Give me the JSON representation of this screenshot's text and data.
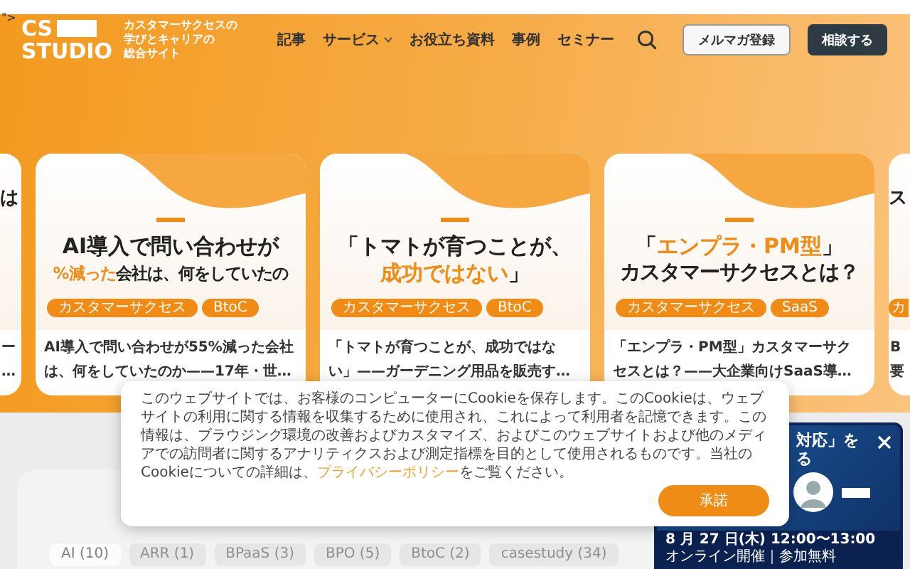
{
  "stray_text": "\">",
  "header": {
    "logo": {
      "top": "CS",
      "bottom": "STUDIO"
    },
    "tagline": [
      "カスタマーサクセスの",
      "学びとキャリアの",
      "総合サイト"
    ],
    "nav": [
      {
        "label": "記事",
        "dropdown": false
      },
      {
        "label": "サービス",
        "dropdown": true
      },
      {
        "label": "お役立ち資料",
        "dropdown": false
      },
      {
        "label": "事例",
        "dropdown": false
      },
      {
        "label": "セミナー",
        "dropdown": false
      }
    ],
    "buttons": [
      {
        "label": "メルマガ登録",
        "kind": "outline"
      },
      {
        "label": "相談する",
        "kind": "dark"
      }
    ]
  },
  "cards": [
    {
      "headline": [
        [
          {
            "text": "は",
            "accent": false
          }
        ]
      ],
      "title": [
        "ー",
        "…"
      ]
    },
    {
      "headline": [
        [
          {
            "text": "AI導入で問い合わせが",
            "accent": false
          }
        ],
        [
          {
            "text": "%減った",
            "accent": true
          },
          {
            "text": "会社は、何をしていたの",
            "accent": false
          }
        ]
      ],
      "tags": [
        "カスタマーサクセス",
        "BtoC"
      ],
      "title": [
        "AI導入で問い合わせが55%減った会社",
        "は、何をしていたのか——17年・世…"
      ]
    },
    {
      "headline": [
        [
          {
            "text": "「トマトが育つことが、",
            "accent": false
          }
        ],
        [
          {
            "text": "成功ではない",
            "accent": true
          },
          {
            "text": "」",
            "accent": false
          }
        ]
      ],
      "tags": [
        "カスタマーサクセス",
        "BtoC"
      ],
      "title": [
        "「トマトが育つことが、成功ではな",
        "い」——ガーデニング用品を販売す…"
      ]
    },
    {
      "headline": [
        [
          {
            "text": "「",
            "accent": false
          },
          {
            "text": "エンプラ・PM型",
            "accent": true
          },
          {
            "text": "」",
            "accent": false
          }
        ],
        [
          {
            "text": "カスタマーサクセスとは？",
            "accent": false
          }
        ]
      ],
      "tags": [
        "カスタマーサクセス",
        "SaaS"
      ],
      "title": [
        "「エンプラ・PM型」カスタマーサク",
        "セスとは？——大企業向けSaaS導…"
      ]
    },
    {
      "headline": [
        [
          {
            "text": "ス",
            "accent": false
          }
        ]
      ],
      "tags": [
        "カ"
      ],
      "title": [
        "B",
        "要"
      ]
    }
  ],
  "tag_chips": [
    {
      "label": "AI (10)",
      "selected": true
    },
    {
      "label": "ARR (1)",
      "selected": false
    },
    {
      "label": "BPaaS (3)",
      "selected": false
    },
    {
      "label": "BPO (5)",
      "selected": false
    },
    {
      "label": "BtoC (2)",
      "selected": false
    },
    {
      "label": "casestudy (34)",
      "selected": false
    }
  ],
  "cookie_banner": {
    "text": "このウェブサイトでは、お客様のコンピューターにCookieを保存します。このCookieは、ウェブサイトの利用に関する情報を収集するために使用され、これによって利用者を記憶できます。この情報は、ブラウジング環境の改善およびカスタマイズ、およびこのウェブサイトおよび他のメディアでの訪問者に関するアナリティクスおよび測定指標を目的として使用されるものです。当社のCookieについての詳細は、",
    "link": "プライバシーポリシー",
    "text_after": "をご覧ください。",
    "button": "承諾"
  },
  "ad": {
    "headline": [
      "対応」を",
      "る"
    ],
    "date": "8 月 27 日(木) 12:00〜13:00",
    "note": "オンライン開催｜参加無料"
  }
}
